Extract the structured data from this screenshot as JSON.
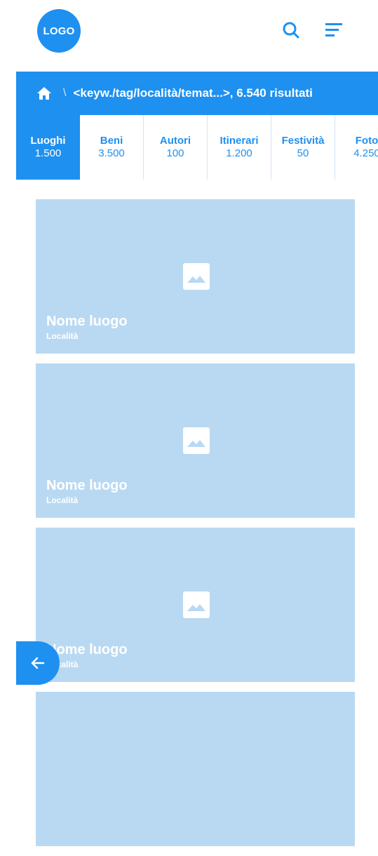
{
  "header": {
    "logo_text": "LOGO"
  },
  "breadcrumb": {
    "separator": "\\",
    "text": "<keyw./tag/località/temat...>, 6.540 risultati"
  },
  "tabs": [
    {
      "label": "Luoghi",
      "count": "1.500",
      "active": true
    },
    {
      "label": "Beni",
      "count": "3.500",
      "active": false
    },
    {
      "label": "Autori",
      "count": "100",
      "active": false
    },
    {
      "label": "Itinerari",
      "count": "1.200",
      "active": false
    },
    {
      "label": "Festività",
      "count": "50",
      "active": false
    },
    {
      "label": "Foto",
      "count": "4.250",
      "active": false
    }
  ],
  "cards": [
    {
      "title": "Nome luogo",
      "subtitle": "Località"
    },
    {
      "title": "Nome luogo",
      "subtitle": "Località"
    },
    {
      "title": "Nome luogo",
      "subtitle": "Località"
    },
    {
      "title": "",
      "subtitle": ""
    }
  ],
  "colors": {
    "accent": "#1e90f0",
    "card_bg": "#b9d9f2"
  },
  "icons": {
    "search": "search-icon",
    "menu": "menu-icon",
    "home": "home-icon",
    "image": "image-placeholder-icon",
    "back": "arrow-left-icon"
  }
}
